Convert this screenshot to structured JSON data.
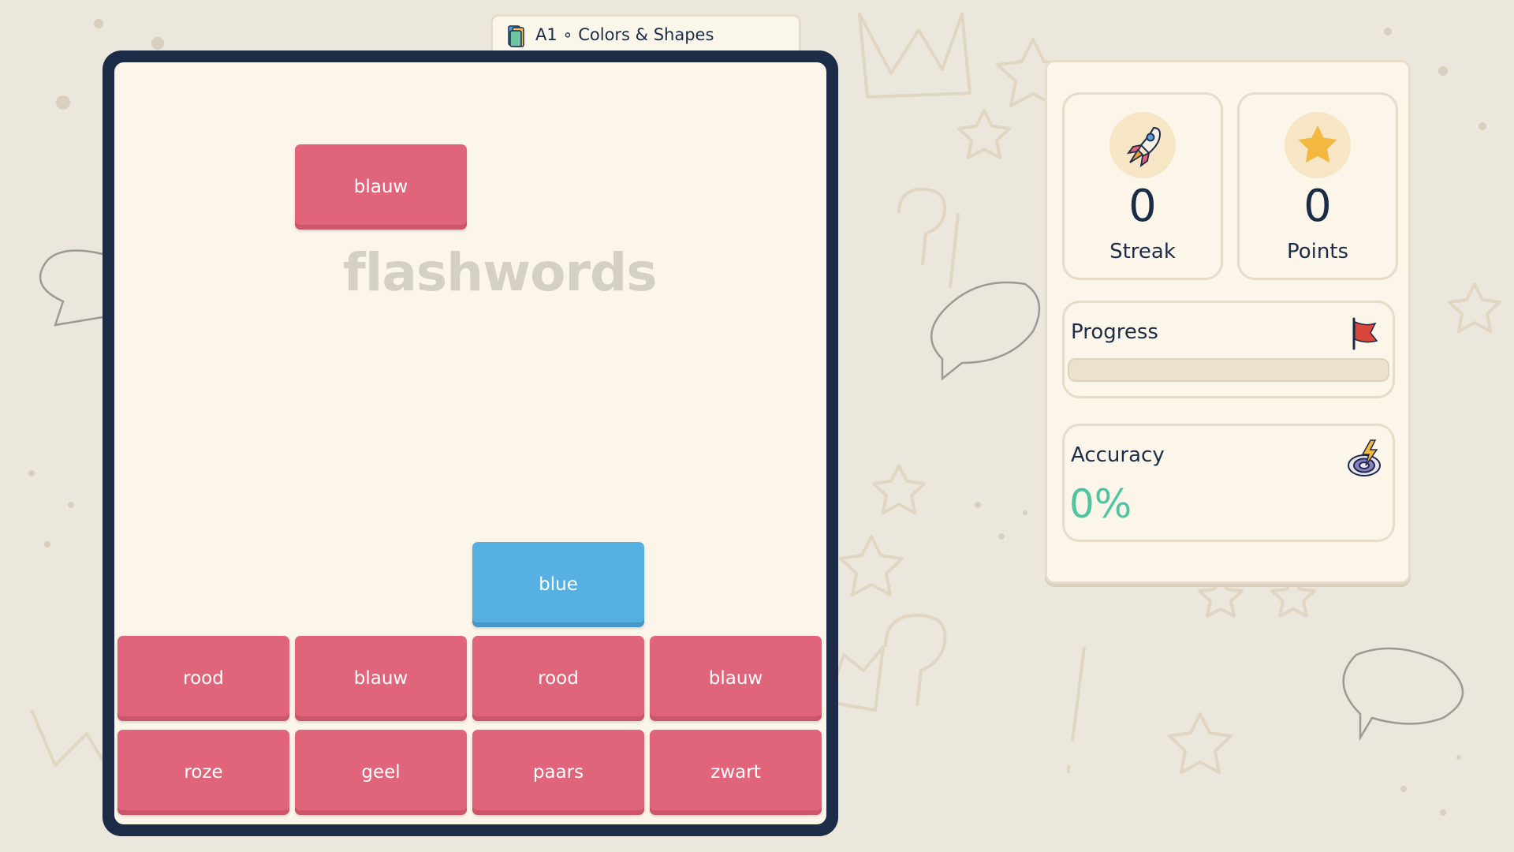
{
  "level": {
    "label": "A1 ∘ Colors & Shapes",
    "icon": "book-stack-icon"
  },
  "board": {
    "watermark": "flashwords",
    "falling_tiles": [
      {
        "word": "blauw",
        "color": "red"
      },
      {
        "word": "blue",
        "color": "blue"
      }
    ],
    "stack_rows": [
      [
        "rood",
        "blauw",
        "rood",
        "blauw"
      ],
      [
        "roze",
        "geel",
        "paars",
        "zwart"
      ]
    ]
  },
  "stats": {
    "streak": {
      "value": "0",
      "label": "Streak",
      "icon": "rocket-icon"
    },
    "points": {
      "value": "0",
      "label": "Points",
      "icon": "star-icon"
    },
    "progress": {
      "label": "Progress",
      "fraction": 0,
      "icon": "flag-icon"
    },
    "accuracy": {
      "label": "Accuracy",
      "value": "0%",
      "icon": "target-icon"
    }
  },
  "colors": {
    "board_frame": "#1c2b46",
    "tile_red": "#e0657a",
    "tile_blue": "#56b0e2",
    "accent_green": "#4fc4a0",
    "panel_bg": "#fcf6ea"
  }
}
